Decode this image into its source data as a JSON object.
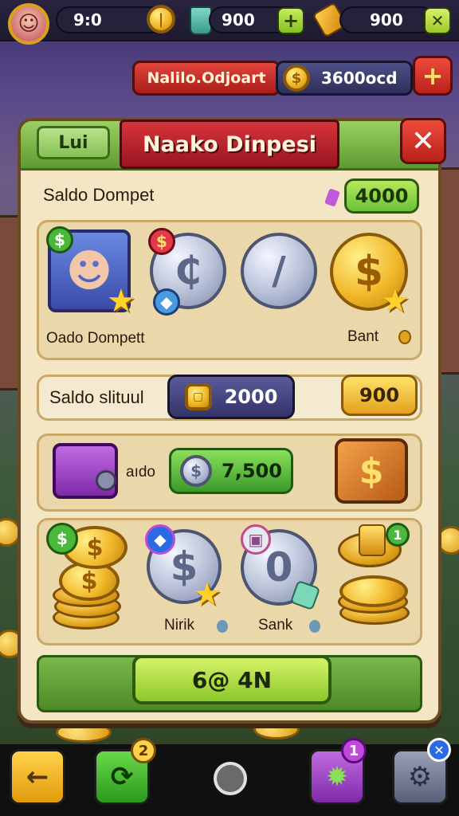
{
  "top_bar": {
    "avatar_icon": "female-avatar-icon",
    "resource_1_value": "9:0",
    "resource_2_value": "900",
    "resource_3_value": "900",
    "resource_2_add_label": "+",
    "resource_3_close_label": "✕"
  },
  "sub_bar": {
    "red_label": "Nalilo.Odjoart",
    "balance_value": "3600ocd",
    "add_label": "+"
  },
  "dialog": {
    "tab_label": "Lui",
    "title": "Naako Dinpesi",
    "close_label": "✕",
    "wallet_label": "Saldo Dompet",
    "wallet_value": "4000",
    "row1": {
      "left_label": "Oado Dompett",
      "right_label": "Bant"
    },
    "row2": {
      "label": "Saldo slituul",
      "value": "2000",
      "right_value": "900"
    },
    "row3": {
      "label": "aıdo",
      "value": "7,500"
    },
    "row4": {
      "label_mid": "Nirik",
      "label_right": "Sank",
      "badge_count": "1"
    },
    "action_button": "6@ 4N"
  },
  "bottom_nav": {
    "back_label": "←",
    "refresh_badge": "2",
    "notif_badge": "1"
  },
  "colors": {
    "accent_green": "#6cc23a",
    "accent_red": "#d6343a",
    "gold": "#f2b82a",
    "parchment": "#f4e6c4"
  }
}
